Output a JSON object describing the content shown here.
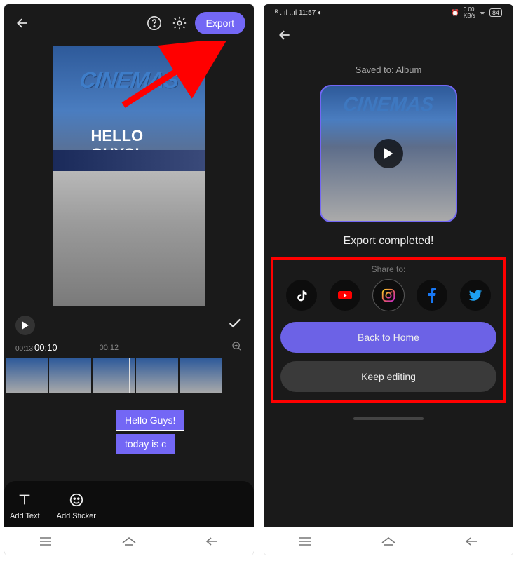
{
  "left": {
    "export_label": "Export",
    "preview_sign": "CINEMAS",
    "preview_overlay": "HELLO GUYS!",
    "time_total": "00:13",
    "time_current": "00:10",
    "time_marker": "00:12",
    "chip_1": "Hello Guys!",
    "chip_2": "today is c",
    "tool_text": "Add Text",
    "tool_sticker": "Add Sticker"
  },
  "right": {
    "status_time": "11:57",
    "status_battery": "84",
    "saved_to": "Saved to: Album",
    "thumb_sign": "CINEMAS",
    "export_complete": "Export completed!",
    "share_to": "Share to:",
    "back_home": "Back to Home",
    "keep_editing": "Keep editing"
  }
}
